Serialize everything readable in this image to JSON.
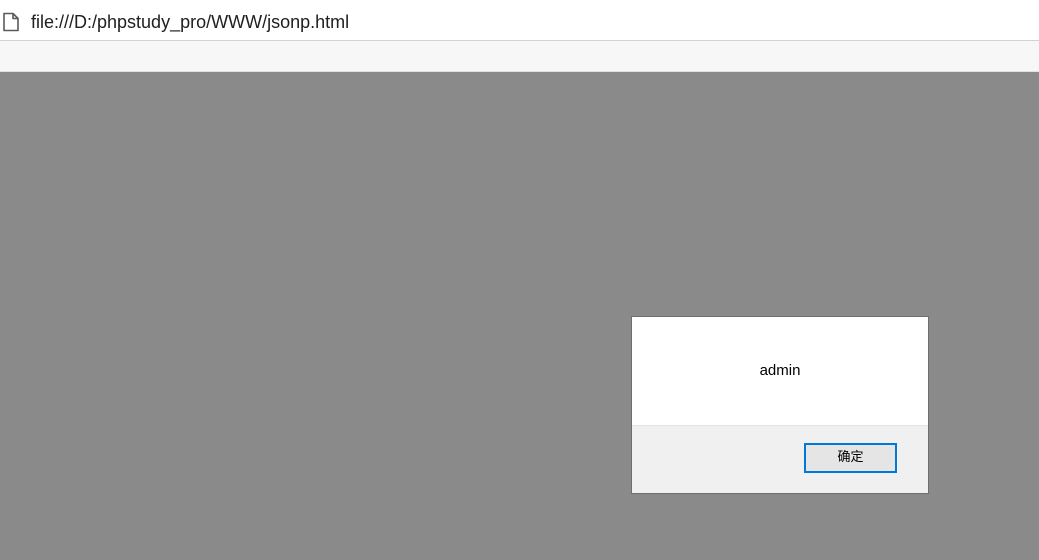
{
  "browser": {
    "address_bar": {
      "icon": "page-icon",
      "url": "file:///D:/phpstudy_pro/WWW/jsonp.html"
    }
  },
  "dialog": {
    "message": "admin",
    "ok_label": "确定",
    "accent_color": "#0078d7"
  },
  "colors": {
    "overlay": "#8a8a8a",
    "dialog_footer": "#f0f0f0"
  }
}
